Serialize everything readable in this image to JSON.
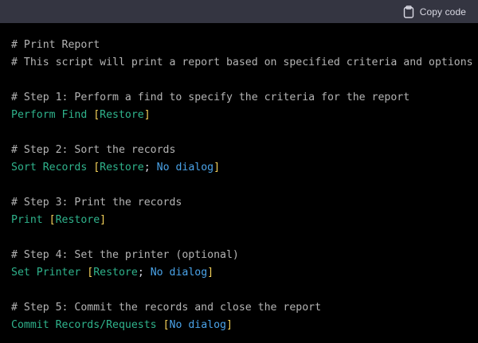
{
  "header": {
    "copy_label": "Copy code",
    "copy_icon": "clipboard-icon"
  },
  "colors": {
    "header_bg": "#343541",
    "code_bg": "#000000",
    "comment": "#b4b4b4",
    "keyword": "#2fb38c",
    "bracket": "#f5d25a",
    "dialog": "#4aa3e8"
  },
  "code": {
    "l1": "# Print Report",
    "l2": "# This script will print a report based on specified criteria and options",
    "l4": "# Step 1: Perform a find to specify the criteria for the report",
    "l5_cmd": "Perform Find ",
    "l5_open": "[",
    "l5_opt": "Restore",
    "l5_close": "]",
    "l7": "# Step 2: Sort the records",
    "l8_cmd": "Sort Records ",
    "l8_open": "[",
    "l8_opt": "Restore",
    "l8_sep": "; ",
    "l8_opt2": "No dialog",
    "l8_close": "]",
    "l10": "# Step 3: Print the records",
    "l11_cmd": "Print ",
    "l11_open": "[",
    "l11_opt": "Restore",
    "l11_close": "]",
    "l13": "# Step 4: Set the printer (optional)",
    "l14_cmd": "Set Printer ",
    "l14_open": "[",
    "l14_opt": "Restore",
    "l14_sep": "; ",
    "l14_opt2": "No dialog",
    "l14_close": "]",
    "l16": "# Step 5: Commit the records and close the report",
    "l17_cmd": "Commit Records/Requests ",
    "l17_open": "[",
    "l17_opt": "No dialog",
    "l17_close": "]"
  }
}
